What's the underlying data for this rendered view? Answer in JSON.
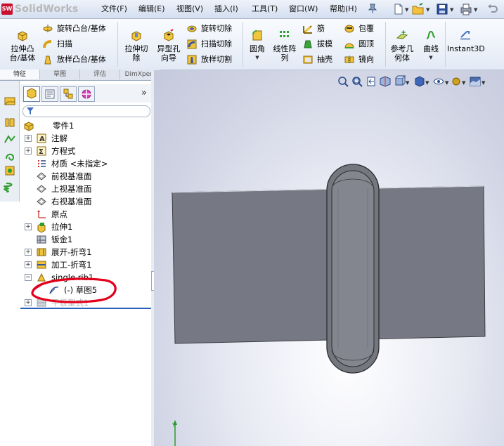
{
  "app": {
    "brand": "SolidWorks",
    "brand_badge": "SW"
  },
  "menu": [
    "文件(F)",
    "编辑(E)",
    "视图(V)",
    "插入(I)",
    "工具(T)",
    "窗口(W)",
    "帮助(H)"
  ],
  "ribbon": {
    "extrude_boss": "拉伸凸\n台/基体",
    "revolve_boss": "旋转凸台/基体",
    "sweep": "扫描",
    "loft_boss": "放样凸台/基体",
    "extrude_cut": "拉伸切\n除",
    "hole_wizard": "异型孔\n向导",
    "revolve_cut": "旋转切除",
    "sweep_cut": "扫描切除",
    "loft_cut": "放样切割",
    "fillet": "圆角",
    "linear_pattern": "线性阵\n列",
    "rib": "筋",
    "draft": "拔模",
    "shell": "抽壳",
    "wrap": "包覆",
    "dome": "圆顶",
    "mirror": "镜向",
    "ref_geometry": "参考几\n何体",
    "curves": "曲线",
    "instant3d": "Instant3D"
  },
  "cm_tabs": [
    "特征",
    "草图",
    "评估",
    "DimXpert"
  ],
  "tree": [
    {
      "label": "零件1",
      "expander": "",
      "icon": "part-icon"
    },
    {
      "label": "注解",
      "expander": "+",
      "icon": "annotations-icon"
    },
    {
      "label": "方程式",
      "expander": "+",
      "icon": "equations-icon"
    },
    {
      "label": "材质 <未指定>",
      "expander": "",
      "icon": "material-icon"
    },
    {
      "label": "前视基准面",
      "expander": "",
      "icon": "plane-icon"
    },
    {
      "label": "上视基准面",
      "expander": "",
      "icon": "plane-icon"
    },
    {
      "label": "右视基准面",
      "expander": "",
      "icon": "plane-icon"
    },
    {
      "label": "原点",
      "expander": "",
      "icon": "origin-icon"
    },
    {
      "label": "拉伸1",
      "expander": "+",
      "icon": "extrude-feature-icon"
    },
    {
      "label": "钣金1",
      "expander": "",
      "icon": "sheetmetal-icon"
    },
    {
      "label": "展开-折弯1",
      "expander": "+",
      "icon": "flatten-bends-icon"
    },
    {
      "label": "加工-折弯1",
      "expander": "+",
      "icon": "process-bends-icon"
    },
    {
      "label": "single rib1",
      "expander": "−",
      "icon": "rib-feature-icon"
    },
    {
      "label": "(-) 草图5",
      "expander": "",
      "icon": "sketch-icon"
    },
    {
      "label": "平板型式1",
      "expander": "+",
      "icon": "flat-pattern-icon"
    }
  ],
  "colors": {
    "accent": "#2b60b8",
    "highlight_circle": "#e3001b",
    "part_face": "#767884"
  }
}
